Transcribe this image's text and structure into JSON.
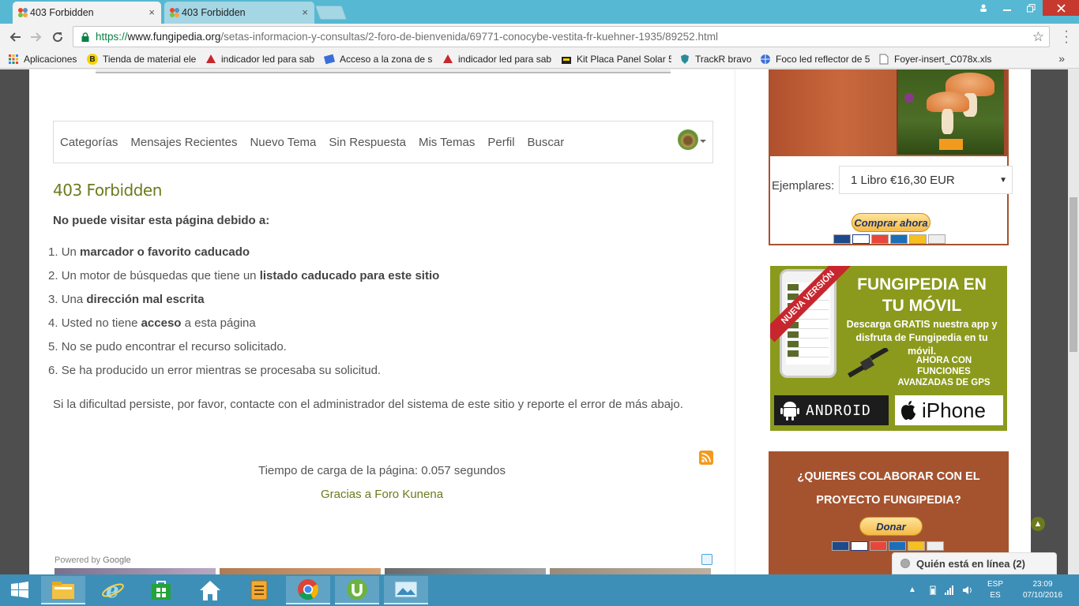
{
  "browser": {
    "tabs": [
      {
        "title": "403 Forbidden",
        "active": true
      },
      {
        "title": "403 Forbidden",
        "active": false
      }
    ],
    "close_glyph": "×",
    "url_scheme": "https://",
    "url_host": "www.fungipedia.org",
    "url_path": "/setas-informacion-y-consultas/2-foro-de-bienvenida/69771-conocybe-vestita-fr-kuehner-1935/89252.html",
    "bookmarks": [
      {
        "label": "Aplicaciones",
        "icon": "apps-grid-icon"
      },
      {
        "label": "Tienda de material ele",
        "icon": "b-circle-icon"
      },
      {
        "label": "indicador led para sab",
        "icon": "robot-red-icon"
      },
      {
        "label": "Acceso a la zona de s",
        "icon": "blue-square-icon"
      },
      {
        "label": "indicador led para sab",
        "icon": "robot-red-icon"
      },
      {
        "label": "Kit Placa Panel Solar 5",
        "icon": "shop-bag-icon"
      },
      {
        "label": "TrackR bravo",
        "icon": "shield-icon"
      },
      {
        "label": "Foco led reflector de 5",
        "icon": "globe-icon"
      },
      {
        "label": "Foyer-insert_C078x.xls",
        "icon": "document-icon"
      }
    ],
    "bookmarks_more": "»"
  },
  "nav": {
    "items": [
      "Categorías",
      "Mensajes Recientes",
      "Nuevo Tema",
      "Sin Respuesta",
      "Mis Temas",
      "Perfil",
      "Buscar"
    ]
  },
  "content": {
    "title": "403 Forbidden",
    "subtitle": "No puede visitar esta página debido a:",
    "reasons": [
      {
        "num": "1.",
        "pre": "Un ",
        "bold": "marcador o favorito caducado",
        "post": ""
      },
      {
        "num": "2.",
        "pre": "Un motor de búsquedas que tiene un ",
        "bold": "listado caducado para este sitio",
        "post": ""
      },
      {
        "num": "3.",
        "pre": "Una ",
        "bold": "dirección mal escrita",
        "post": ""
      },
      {
        "num": "4.",
        "pre": "Usted no tiene ",
        "bold": "acceso",
        "post": " a esta página"
      },
      {
        "num": "5.",
        "pre": "No se pudo encontrar el recurso solicitado.",
        "bold": "",
        "post": ""
      },
      {
        "num": "6.",
        "pre": "Se ha producido un error mientras se procesaba su solicitud.",
        "bold": "",
        "post": ""
      }
    ],
    "persist": "Si la dificultad persiste, por favor, contacte con el administrador del sistema de este sitio y reporte el error de más abajo.",
    "load_time": "Tiempo de carga de la página: 0.057 segundos",
    "credit": "Gracias a Foro Kunena",
    "powered_prefix": "Powered by ",
    "powered_brand": "Google"
  },
  "sidebar": {
    "ejemplares_label": "Ejemplares:",
    "ejemplares_value": "1 Libro €16,30 EUR",
    "buy_label": "Comprar ahora",
    "app": {
      "ribbon": "NUEVA VERSIÓN",
      "title_line1": "FUNGIPEDIA EN",
      "title_line2": "TU MÓVIL",
      "desc": "Descarga GRATIS nuestra app y disfruta de Fungipedia en tu móvil.",
      "gps": "AHORA CON FUNCIONES AVANZADAS DE GPS",
      "android": "ANDROID",
      "iphone": "iPhone"
    },
    "collab_line1": "¿QUIERES COLABORAR CON EL",
    "collab_line2": "PROYECTO FUNGIPEDIA?",
    "donate_label": "Donar",
    "online": "Quién está en línea (2)"
  },
  "taskbar": {
    "lang_top": "ESP",
    "lang_bottom": "ES",
    "time": "23:09",
    "date": "07/10/2016"
  },
  "colors": {
    "accent_olive": "#6e7a1e",
    "sidebar_brown": "#a5532f",
    "app_green": "#8b9a1c",
    "chrome_blue": "#56b8d2",
    "taskbar_blue": "#3d8fb7"
  }
}
